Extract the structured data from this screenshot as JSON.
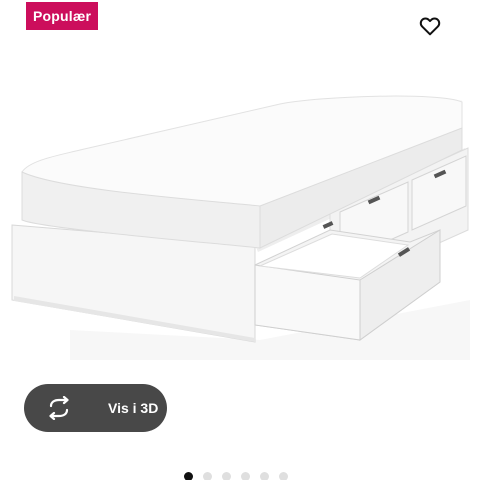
{
  "badge": {
    "label": "Populær",
    "color": "#cc0e5c"
  },
  "favorite": {
    "icon": "heart-outline-icon"
  },
  "product_image": {
    "description_icon": "bed-frame-with-drawers-image"
  },
  "view_3d": {
    "label": "Vis i 3D",
    "icon": "rotate-3d-icon",
    "background": "#484848"
  },
  "carousel": {
    "total": 6,
    "active": 1
  }
}
